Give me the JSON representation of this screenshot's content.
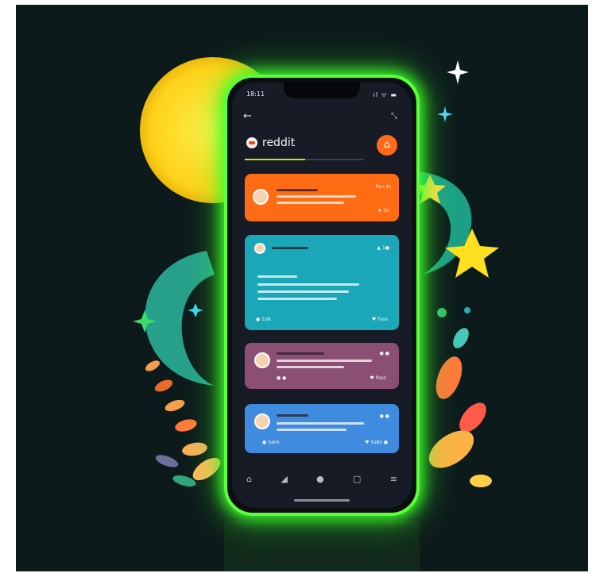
{
  "status": {
    "time": "18:11",
    "icons": "ıl ᯤ ▬"
  },
  "header": {
    "back_icon": "arrow-left-icon",
    "share_icon": "close-expand-icon",
    "brand": "reddit",
    "home_icon": "home-icon"
  },
  "posts": [
    {
      "right_meta": "Pan 4s",
      "footer_meta": "♦ 0n"
    },
    {
      "right_meta": "▲ 1●",
      "footer_left": "● 1sN",
      "footer_right": "♥ Fass"
    },
    {
      "right_meta": "● ●",
      "footer_left": "● ●",
      "footer_right": "♥ Pasz"
    },
    {
      "right_meta": "● ●",
      "footer_left": "● Sans",
      "footer_right": "♥ Sa8s ●"
    }
  ],
  "bottom_nav": [
    "⌂",
    "◢",
    "●",
    "▢",
    "≡"
  ]
}
